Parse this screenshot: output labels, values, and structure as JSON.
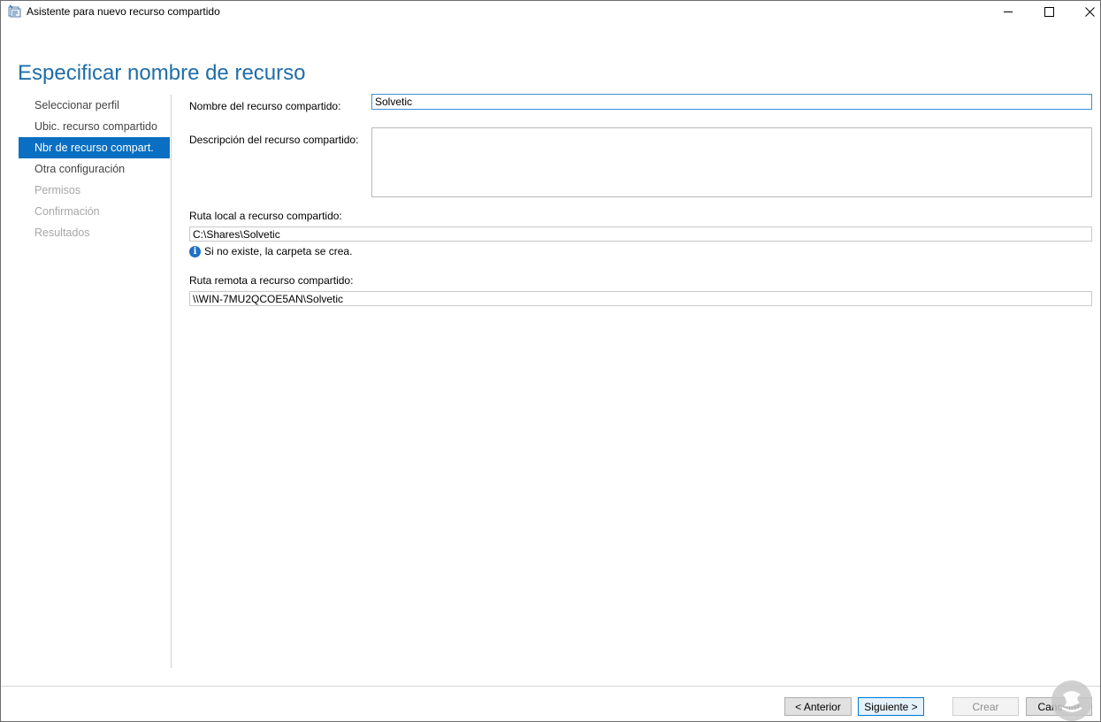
{
  "window": {
    "title": "Asistente para nuevo recurso compartido",
    "icon": "share-folder-icon"
  },
  "header": {
    "title": "Especificar nombre de recurso"
  },
  "nav": {
    "items": [
      {
        "label": "Seleccionar perfil",
        "state": "normal"
      },
      {
        "label": "Ubic. recurso compartido",
        "state": "normal"
      },
      {
        "label": "Nbr de recurso compart.",
        "state": "active"
      },
      {
        "label": "Otra configuración",
        "state": "normal"
      },
      {
        "label": "Permisos",
        "state": "disabled"
      },
      {
        "label": "Confirmación",
        "state": "disabled"
      },
      {
        "label": "Resultados",
        "state": "disabled"
      }
    ]
  },
  "form": {
    "share_name_label": "Nombre del recurso compartido:",
    "share_name_value": "Solvetic",
    "description_label": "Descripción del recurso compartido:",
    "description_value": "",
    "local_path_label": "Ruta local a recurso compartido:",
    "local_path_value": "C:\\Shares\\Solvetic",
    "info_text": "Si no existe, la carpeta se crea.",
    "remote_path_label": "Ruta remota a recurso compartido:",
    "remote_path_value": "\\\\WIN-7MU2QCOE5AN\\Solvetic"
  },
  "footer": {
    "back_label": "< Anterior",
    "next_label": "Siguiente >",
    "create_label": "Crear",
    "cancel_label": "Cancelar"
  },
  "colors": {
    "accent": "#0a6fc2",
    "header_text": "#1f6da8",
    "logo": "#c8c8c8"
  }
}
